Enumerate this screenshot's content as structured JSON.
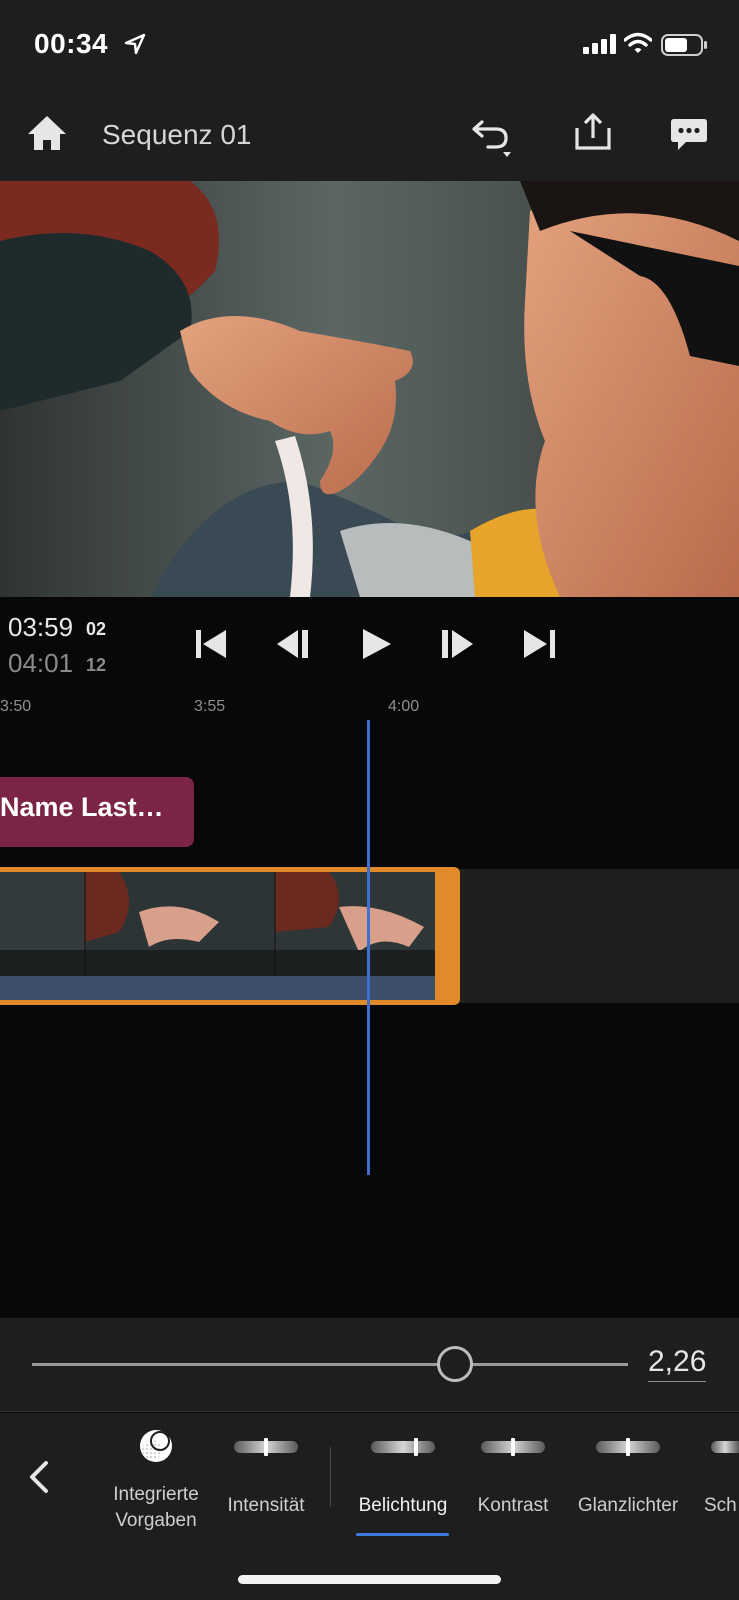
{
  "status_bar": {
    "time": "00:34"
  },
  "header": {
    "title": "Sequenz 01"
  },
  "transport": {
    "current_time": "03:59",
    "current_frames": "02",
    "total_time": "04:01",
    "total_frames": "12"
  },
  "timeline": {
    "ruler": [
      "3:50",
      "3:55",
      "4:00"
    ],
    "title_clip_label": "Name Last…"
  },
  "adjustment": {
    "value": "2,26",
    "slider_fraction": 0.71
  },
  "tools": {
    "presets_line1": "Integrierte",
    "presets_line2": "Vorgaben",
    "items": [
      "Intensität",
      "Belichtung",
      "Kontrast",
      "Glanzlichter",
      "Sch"
    ],
    "active": "Belichtung"
  },
  "colors": {
    "accent_blue": "#3f6fd2",
    "clip_orange": "#e08a2c",
    "title_clip": "#7c2446",
    "panel": "#1e1e1e"
  }
}
